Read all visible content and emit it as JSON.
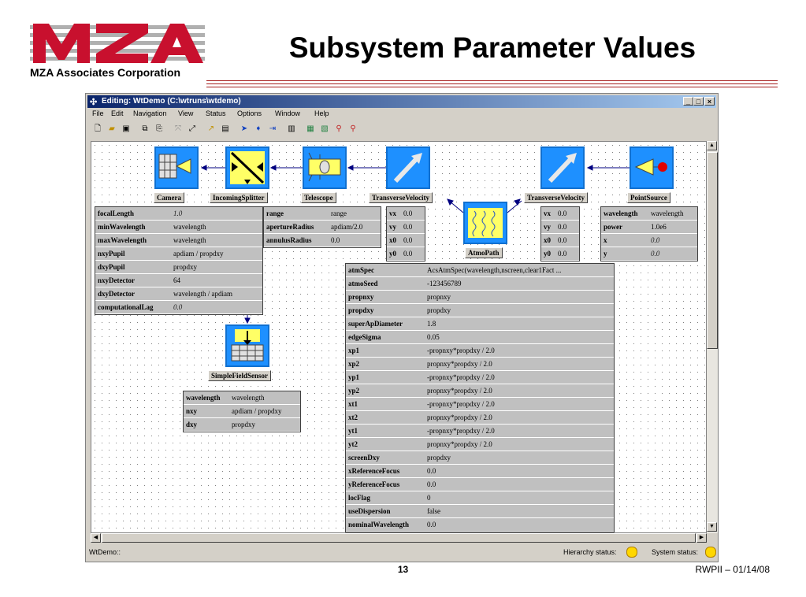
{
  "slide": {
    "logo_text": "MZA",
    "company": "MZA Associates Corporation",
    "title": "Subsystem Parameter Values",
    "page_number": "13",
    "footer_right": "RWPII – 01/14/08"
  },
  "window": {
    "title": "Editing:  WtDemo  (C:\\wtruns\\wtdemo)",
    "menu": [
      "File",
      "Edit",
      "Navigation",
      "View",
      "Status",
      "Options",
      "Window",
      "Help"
    ],
    "status_left": "WtDemo::",
    "hierarchy_status": "Hierarchy status:",
    "system_status": "System status:"
  },
  "blocks": {
    "camera": "Camera",
    "incoming_splitter": "IncomingSplitter",
    "telescope": "Telescope",
    "transverse_velocity_1": "TransverseVelocity",
    "atmo_path": "AtmoPath",
    "transverse_velocity_2": "TransverseVelocity",
    "point_source": "PointSource",
    "simple_field_sensor": "SimpleFieldSensor"
  },
  "params": {
    "camera": [
      [
        "focalLength",
        "1.0"
      ],
      [
        "minWavelength",
        "wavelength"
      ],
      [
        "maxWavelength",
        "wavelength"
      ],
      [
        "nxyPupil",
        "apdiam / propdxy"
      ],
      [
        "dxyPupil",
        "propdxy"
      ],
      [
        "nxyDetector",
        "64"
      ],
      [
        "dxyDetector",
        "wavelength / apdiam"
      ],
      [
        "computationalLag",
        "0.0"
      ]
    ],
    "telescope": [
      [
        "range",
        "range"
      ],
      [
        "apertureRadius",
        "apdiam/2.0"
      ],
      [
        "annulusRadius",
        "0.0"
      ]
    ],
    "tv1": [
      [
        "vx",
        "0.0"
      ],
      [
        "vy",
        "0.0"
      ],
      [
        "x0",
        "0.0"
      ],
      [
        "y0",
        "0.0"
      ]
    ],
    "tv2": [
      [
        "vx",
        "0.0"
      ],
      [
        "vy",
        "0.0"
      ],
      [
        "x0",
        "0.0"
      ],
      [
        "y0",
        "0.0"
      ]
    ],
    "point_source": [
      [
        "wavelength",
        "wavelength"
      ],
      [
        "power",
        "1.0e6"
      ],
      [
        "x",
        "0.0"
      ],
      [
        "y",
        "0.0"
      ]
    ],
    "sensor": [
      [
        "wavelength",
        "wavelength"
      ],
      [
        "nxy",
        "apdiam / propdxy"
      ],
      [
        "dxy",
        "propdxy"
      ]
    ],
    "atmo": [
      [
        "atmSpec",
        "AcsAtmSpec(wavelength,nscreen,clear1Fact ..."
      ],
      [
        "atmoSeed",
        "-123456789"
      ],
      [
        "propnxy",
        "propnxy"
      ],
      [
        "propdxy",
        "propdxy"
      ],
      [
        "superApDiameter",
        "1.8"
      ],
      [
        "edgeSigma",
        "0.05"
      ],
      [
        "xp1",
        "-propnxy*propdxy / 2.0"
      ],
      [
        "xp2",
        "propnxy*propdxy / 2.0"
      ],
      [
        "yp1",
        "-propnxy*propdxy / 2.0"
      ],
      [
        "yp2",
        "propnxy*propdxy / 2.0"
      ],
      [
        "xt1",
        "-propnxy*propdxy / 2.0"
      ],
      [
        "xt2",
        "propnxy*propdxy / 2.0"
      ],
      [
        "yt1",
        "-propnxy*propdxy / 2.0"
      ],
      [
        "yt2",
        "propnxy*propdxy / 2.0"
      ],
      [
        "screenDxy",
        "propdxy"
      ],
      [
        "xReferenceFocus",
        "0.0"
      ],
      [
        "yReferenceFocus",
        "0.0"
      ],
      [
        "locFlag",
        "0"
      ],
      [
        "useDispersion",
        "false"
      ],
      [
        "nominalWavelength",
        "0.0"
      ]
    ]
  }
}
